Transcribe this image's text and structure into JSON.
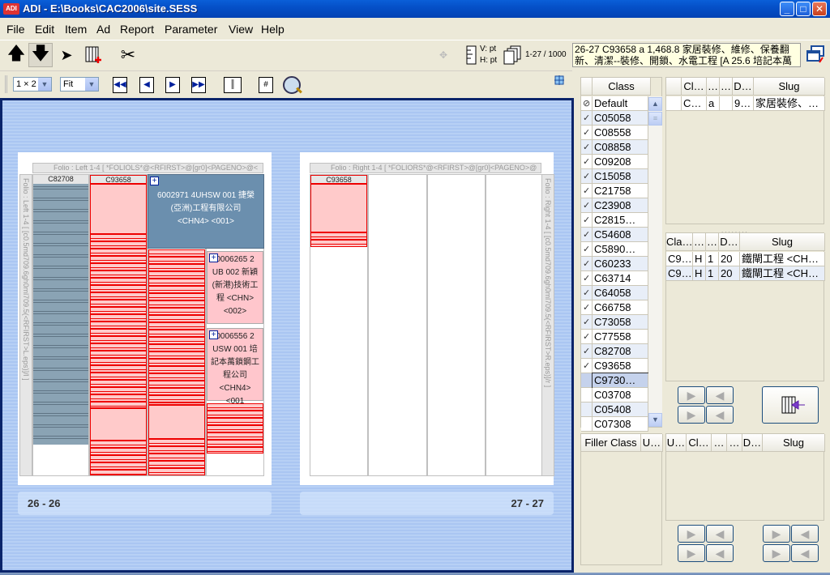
{
  "window": {
    "app_icon_text": "ADI",
    "title": "ADI - E:\\Books\\CAC2006\\site.SESS",
    "minimize": "_",
    "maximize": "□",
    "close": "✕"
  },
  "menu": [
    "File",
    "Edit",
    "Item",
    "Ad",
    "Report",
    "Parameter",
    "View",
    "Help"
  ],
  "toolbar": {
    "icons": [
      "arrow-up-icon",
      "arrow-down-icon",
      "pointer-icon",
      "add-column-icon",
      "scissors-icon"
    ],
    "units": {
      "v": "V: pt",
      "h": "H: pt"
    },
    "page_range": "1-27 / 1000",
    "info_text": "26-27 C93658 a 1,468.8 家居裝修、維修、保養翻新、清潔--裝修、開鎖、水電工程 [A 25.6 培記本萬"
  },
  "toolbar2": {
    "layout_combo": "1 × 2",
    "zoom_combo": "Fit"
  },
  "spread": {
    "left": {
      "folio_top": "Folio : Left 1-4 [ *FOLIOLS*@<RFIRST>@[gr0]<PAGENO>@<",
      "folio_side": "Folio : Left 1-4 [ [c0.5md709.6gh0ml709.5(<RFIRST>L.eps)]/l ]",
      "columns": [
        "C82708",
        "C93658"
      ],
      "ads": [
        {
          "text": "6002971 4UHSW 001 捷榮(亞洲)工程有限公司 <CHN4> <001>"
        },
        {
          "text": "0006265 2 UB 002 新穎(新港)技術工程 <CHN> <002>"
        },
        {
          "text": "0006556 2 USW 001 培記本萬鎖鋼工程公司 <CHN4> <001"
        }
      ],
      "page_label": "26 - 26"
    },
    "right": {
      "folio_top": "Folio : Right 1-4 [ *FOLIORS*@<RFIRST>@[gr0]<PAGENO>@",
      "folio_side": "Folio : Right 1-4 [ [c0.5md709.6gh0ml709.5(<RFIRST>R.eps)]/r ]",
      "columns": [
        "C93658"
      ],
      "page_label": "27 - 27"
    }
  },
  "class_list": {
    "header": "Class",
    "items": [
      {
        "check": "⊘",
        "name": "Default"
      },
      {
        "check": "✓",
        "name": "C05058"
      },
      {
        "check": "✓",
        "name": "C08558"
      },
      {
        "check": "✓",
        "name": "C08858"
      },
      {
        "check": "✓",
        "name": "C09208"
      },
      {
        "check": "✓",
        "name": "C15058"
      },
      {
        "check": "✓",
        "name": "C21758"
      },
      {
        "check": "✓",
        "name": "C23908"
      },
      {
        "check": "✓",
        "name": "C2815…"
      },
      {
        "check": "✓",
        "name": "C54608"
      },
      {
        "check": "✓",
        "name": "C5890…"
      },
      {
        "check": "✓",
        "name": "C60233"
      },
      {
        "check": "✓",
        "name": "C63714"
      },
      {
        "check": "✓",
        "name": "C64058"
      },
      {
        "check": "✓",
        "name": "C66758"
      },
      {
        "check": "✓",
        "name": "C73058"
      },
      {
        "check": "✓",
        "name": "C77558"
      },
      {
        "check": "✓",
        "name": "C82708"
      },
      {
        "check": "✓",
        "name": "C93658"
      },
      {
        "check": "",
        "name": "C9730…"
      },
      {
        "check": "",
        "name": "C03708"
      },
      {
        "check": "",
        "name": "C05408"
      },
      {
        "check": "",
        "name": "C07308"
      }
    ]
  },
  "top_grid": {
    "headers": [
      "",
      "Cl…",
      "…",
      "…",
      "D…",
      "Slug"
    ],
    "rows": [
      [
        "",
        "C…",
        "a",
        "",
        "9…",
        "家居裝修、…"
      ]
    ]
  },
  "mid_grid": {
    "headers": [
      "Cla…",
      "…",
      "…",
      "D…",
      "Slug"
    ],
    "rows": [
      [
        "C9…",
        "H",
        "1",
        "20",
        "鐵閘工程 <CH…"
      ],
      [
        "C9…",
        "H",
        "1",
        "20",
        "鐵閘工程 <CH…"
      ]
    ]
  },
  "filler_grid": {
    "headers": [
      "Filler Class",
      "U…"
    ]
  },
  "bottom_grid": {
    "headers": [
      "U…",
      "Cl…",
      "…",
      "…",
      "D…",
      "Slug"
    ]
  }
}
